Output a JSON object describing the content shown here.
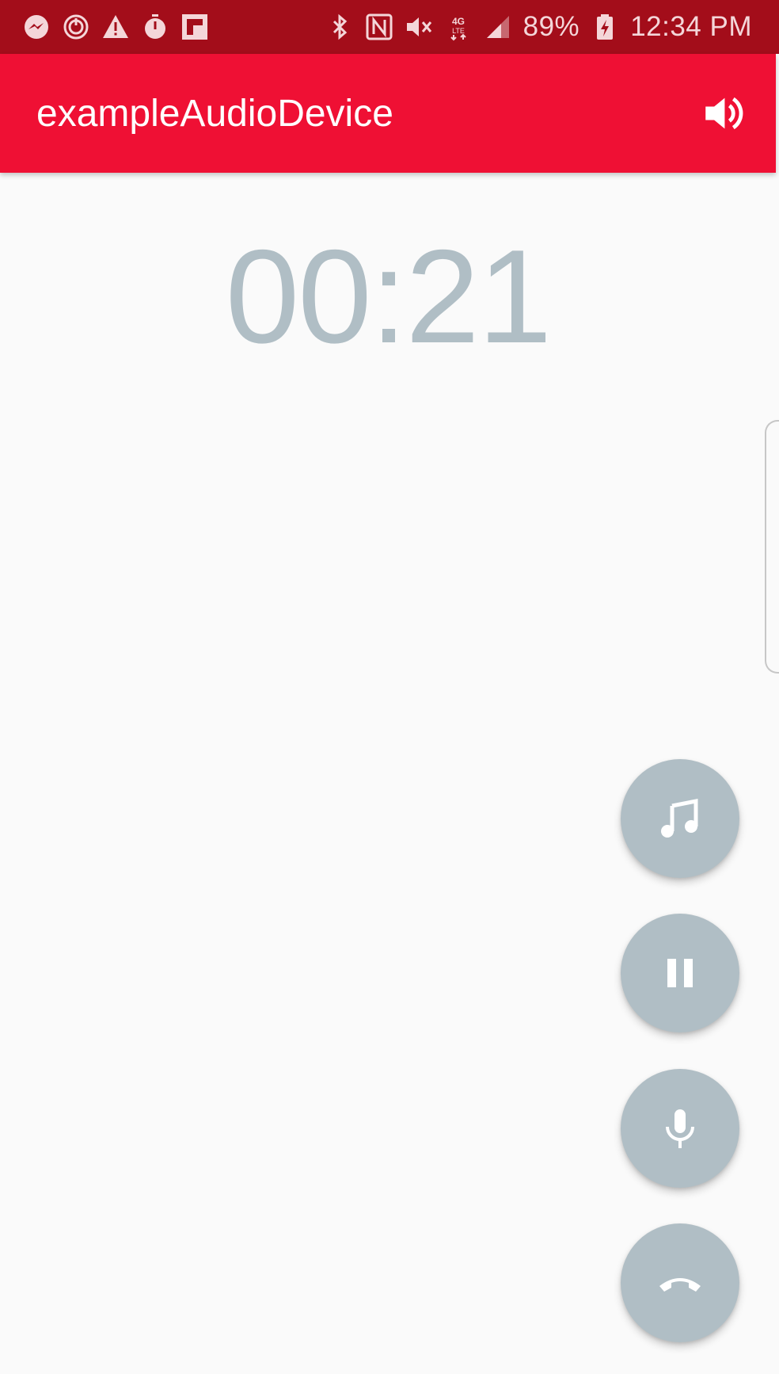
{
  "status_bar": {
    "left_icons": [
      "messenger-icon",
      "sync-icon",
      "warning-icon",
      "stopwatch-icon",
      "flipboard-icon"
    ],
    "right_icons": [
      "bluetooth-icon",
      "nfc-icon",
      "vibrate-mute-icon",
      "4g-lte-icon",
      "signal-icon"
    ],
    "battery_percent": "89%",
    "battery_icon": "battery-charging-icon",
    "time": "12:34 PM"
  },
  "app_bar": {
    "title": "exampleAudioDevice",
    "action_icon": "volume-up-icon"
  },
  "call": {
    "timer": "00:21"
  },
  "fabs": [
    {
      "name": "music-note-icon"
    },
    {
      "name": "pause-icon"
    },
    {
      "name": "mic-icon"
    },
    {
      "name": "hang-up-icon"
    }
  ],
  "colors": {
    "status_bar": "#a30d1a",
    "app_bar": "#ef1034",
    "fab": "#b0bec5",
    "timer": "#b0bec5",
    "background": "#fafafa"
  }
}
